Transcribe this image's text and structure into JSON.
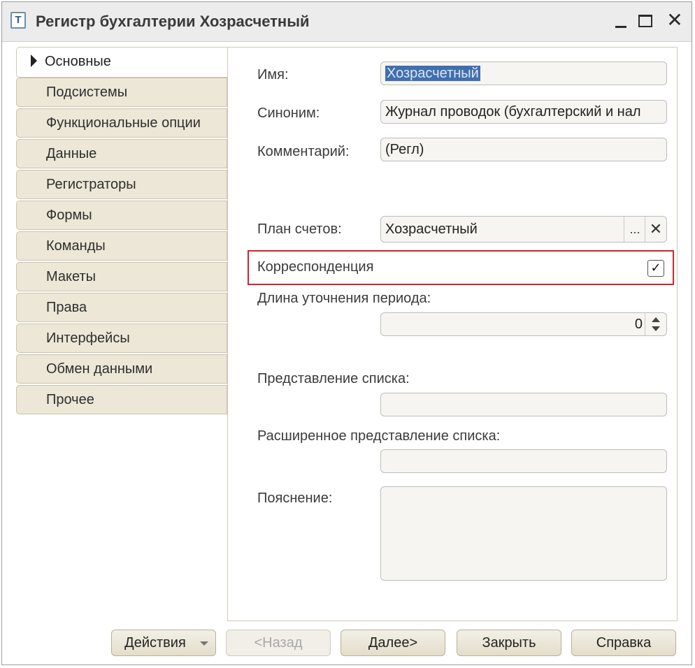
{
  "window": {
    "title": "Регистр бухгалтерии Хозрасчетный",
    "icon": "register-icon",
    "icon_glyph": "Т"
  },
  "controls": {
    "close_glyph": "✕"
  },
  "sidebar": {
    "active": "Основные",
    "items": [
      "Подсистемы",
      "Функциональные опции",
      "Данные",
      "Регистраторы",
      "Формы",
      "Команды",
      "Макеты",
      "Права",
      "Интерфейсы",
      "Обмен данными",
      "Прочее"
    ]
  },
  "form": {
    "name_label": "Имя:",
    "name_value": "Хозрасчетный",
    "synonym_label": "Синоним:",
    "synonym_value": "Журнал проводок (бухгалтерский и нал",
    "comment_label": "Комментарий:",
    "comment_value": "(Регл)",
    "chart_label": "План счетов:",
    "chart_value": "Хозрасчетный",
    "chart_select_glyph": "...",
    "chart_clear_glyph": "✕",
    "correspondence_label": "Корреспонденция",
    "correspondence_checked": true,
    "checkmark_glyph": "✓",
    "period_label": "Длина уточнения периода:",
    "period_value": "0",
    "list_presentation_label": "Представление списка:",
    "list_presentation_value": "",
    "ext_list_presentation_label": "Расширенное представление списка:",
    "ext_list_presentation_value": "",
    "explanation_label": "Пояснение:",
    "explanation_value": ""
  },
  "footer": {
    "actions_label": "Действия",
    "back_label": "<Назад",
    "next_label": "Далее>",
    "close_label": "Закрыть",
    "help_label": "Справка"
  },
  "colors": {
    "highlight_border": "#d0242b",
    "nav_bg": "#ece7d6",
    "selection_bg": "#3f6fb0"
  }
}
